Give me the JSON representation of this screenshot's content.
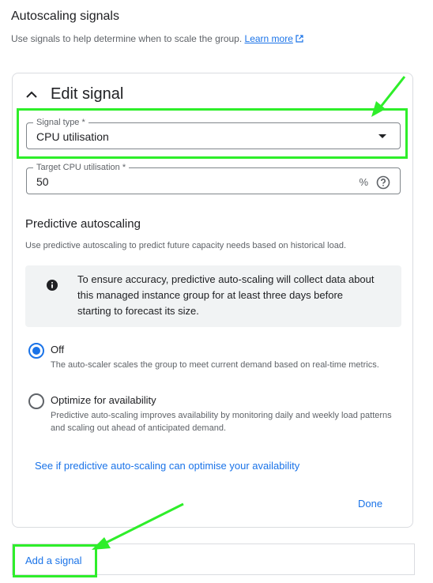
{
  "header": {
    "title": "Autoscaling signals",
    "subtitle": "Use signals to help determine when to scale the group.",
    "learn_more": "Learn more"
  },
  "edit_panel": {
    "title": "Edit signal",
    "signal_type": {
      "label": "Signal type *",
      "value": "CPU utilisation"
    },
    "target": {
      "label": "Target CPU utilisation *",
      "value": "50",
      "unit": "%"
    }
  },
  "predictive": {
    "title": "Predictive autoscaling",
    "description": "Use predictive autoscaling to predict future capacity needs based on historical load.",
    "info": "To ensure accuracy, predictive auto-scaling will collect data about this managed instance group for at least three days before starting to forecast its size.",
    "options": [
      {
        "label": "Off",
        "description": "The auto-scaler scales the group to meet current demand based on real-time metrics.",
        "selected": true
      },
      {
        "label": "Optimize for availability",
        "description": "Predictive auto-scaling improves availability by monitoring daily and weekly load patterns and scaling out ahead of anticipated demand.",
        "selected": false
      }
    ],
    "check_link": "See if predictive auto-scaling can optimise your availability"
  },
  "actions": {
    "done": "Done",
    "add_signal": "Add a signal"
  },
  "colors": {
    "accent": "#1a73e8",
    "highlight": "#2eee2a"
  }
}
